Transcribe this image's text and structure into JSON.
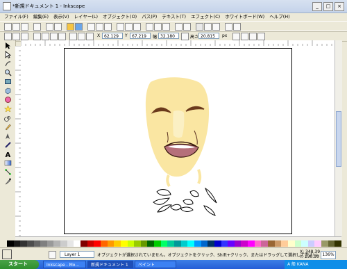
{
  "window": {
    "title": "*新規ドキュメント 1 - Inkscape",
    "controls": [
      "_",
      "□",
      "×"
    ]
  },
  "menu": [
    "ファイル(F)",
    "編集(E)",
    "表示(V)",
    "レイヤー(L)",
    "オブジェクト(O)",
    "パス(P)",
    "テキスト(T)",
    "エフェクト(C)",
    "ホワイトボード(W)",
    "ヘルプ(H)"
  ],
  "toolbar2": {
    "x_label": "X",
    "x_value": "62.129",
    "y_label": "Y",
    "y_value": "67.219",
    "w_label": "幅",
    "w_value": "32.180",
    "h_label": "高さ",
    "h_value": "20.815",
    "unit": "px"
  },
  "status": {
    "layer_label": "Layer 1",
    "message": "オブジェクトが選択されていません。オブジェクトをクリック、Shift+クリック、またはドラッグして選択して下さい。",
    "coord_x": "X: 348.39",
    "coord_y": "Y: 190.30",
    "zoom": "136%"
  },
  "taskbar": {
    "start_label": "スタート",
    "tasks": [
      "Inkscape - Mo...",
      "新規ドキュメント 1",
      "ペイント"
    ],
    "tray_text": "A 般 KANA"
  },
  "colors": {
    "skin": "#fae6a2",
    "highlight": "#fbf0c4",
    "mouth": "#b5707a",
    "eyebrow": "#6b3a1c"
  }
}
